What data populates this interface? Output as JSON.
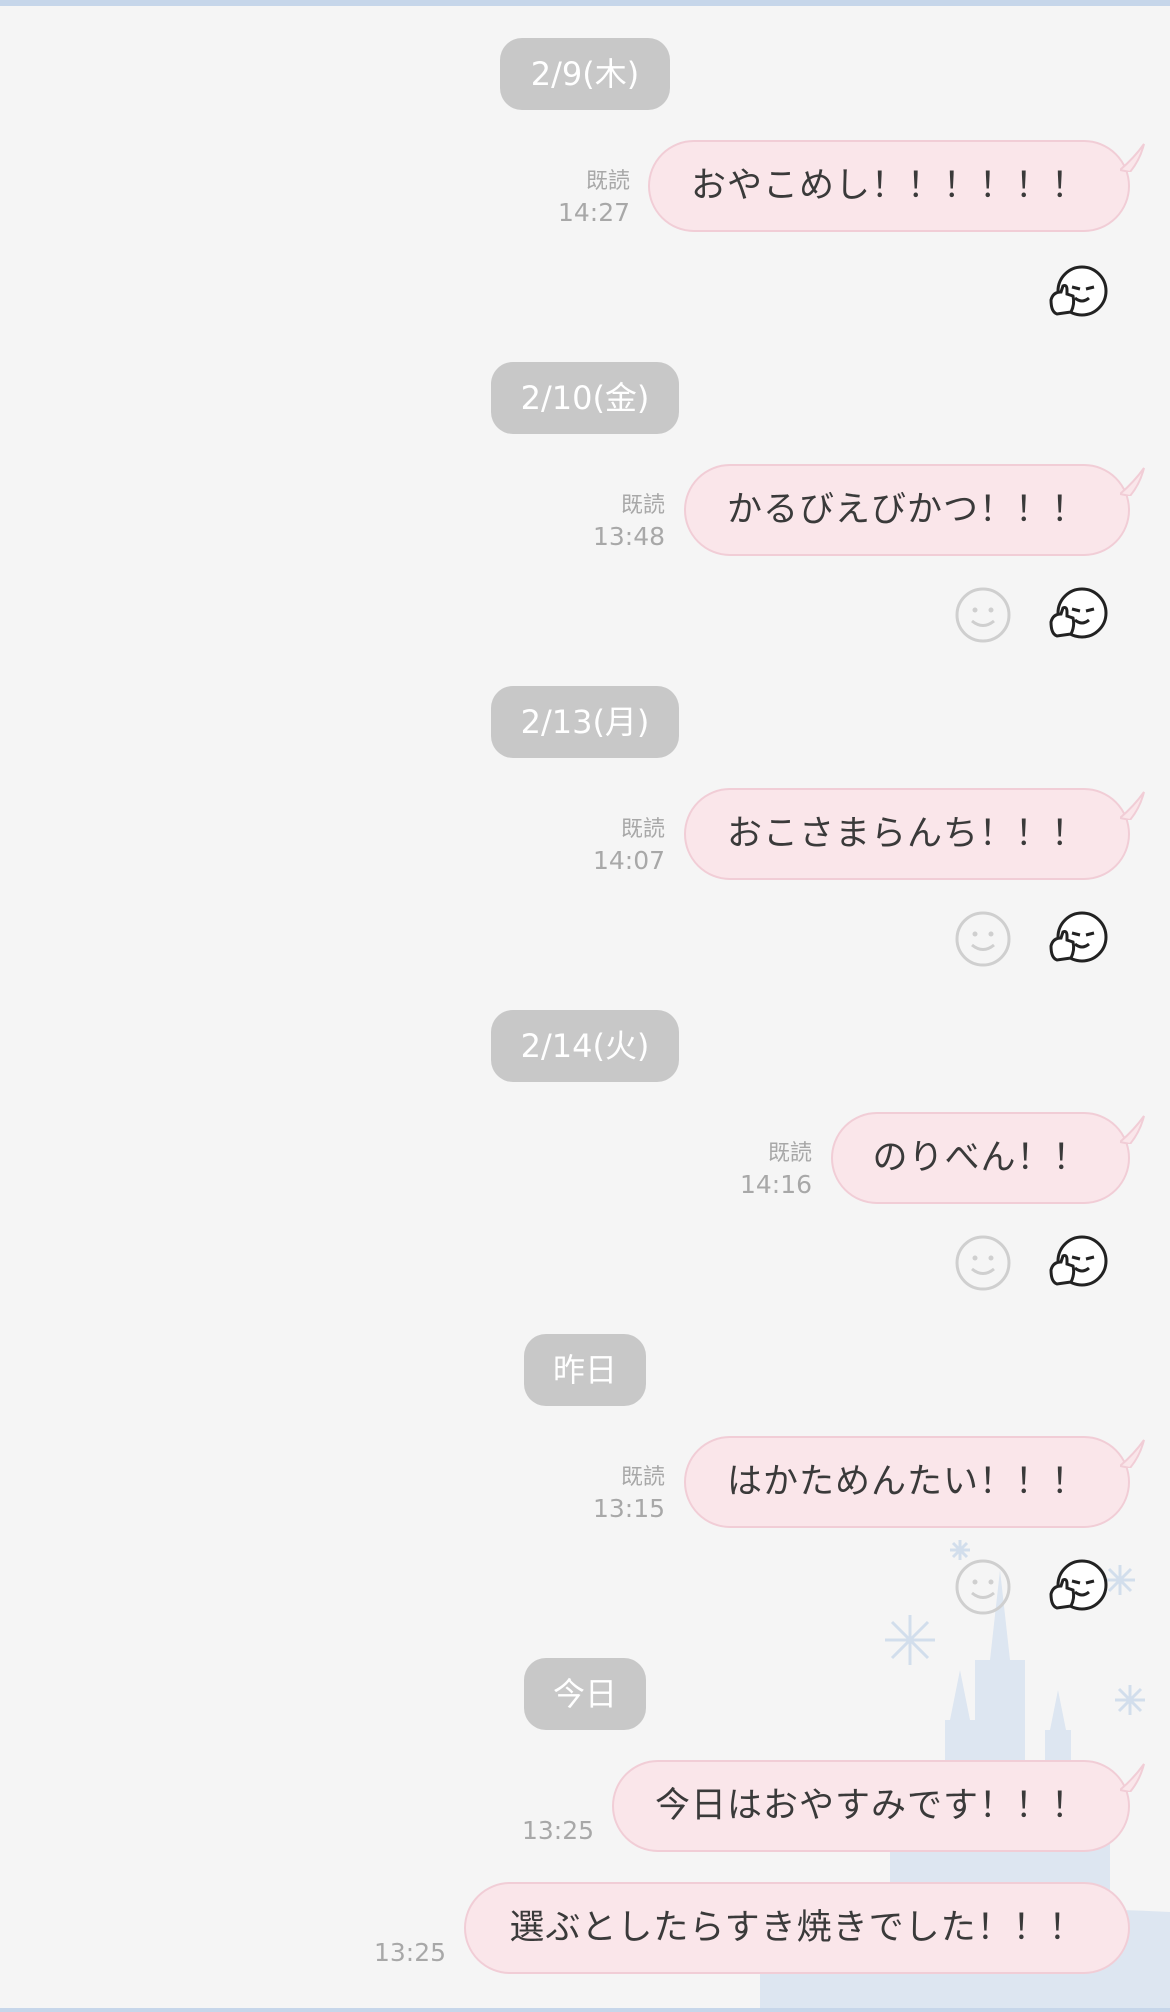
{
  "chat": {
    "dates": [
      {
        "label": "2/9(木)"
      },
      {
        "label": "2/10(金)"
      },
      {
        "label": "2/13(月)"
      },
      {
        "label": "2/14(火)"
      },
      {
        "label": "昨日"
      },
      {
        "label": "今日"
      }
    ],
    "messages": [
      {
        "text": "おやこめし！！！！！！",
        "read": "既読",
        "time": "14:27"
      },
      {
        "text": "かるびえびかつ！！！",
        "read": "既読",
        "time": "13:48"
      },
      {
        "text": "おこさまらんち！！！",
        "read": "既読",
        "time": "14:07"
      },
      {
        "text": "のりべん！！",
        "read": "既読",
        "time": "14:16"
      },
      {
        "text": "はかためんたい！！！",
        "read": "既読",
        "time": "13:15"
      },
      {
        "text": "今日はおやすみです！！！",
        "time": "13:25"
      },
      {
        "text": "選ぶとしたらすき焼きでした！！！",
        "time": "13:25"
      }
    ]
  },
  "icons": {
    "reaction": "smiley-icon",
    "sticker": "thumbs-up-face-icon"
  },
  "colors": {
    "background": "#f5f5f5",
    "bubble": "#fae6ea",
    "bubble_border": "#f1cdd6",
    "date_pill": "#c8c8c8",
    "meta_text": "#a8a8a8"
  }
}
